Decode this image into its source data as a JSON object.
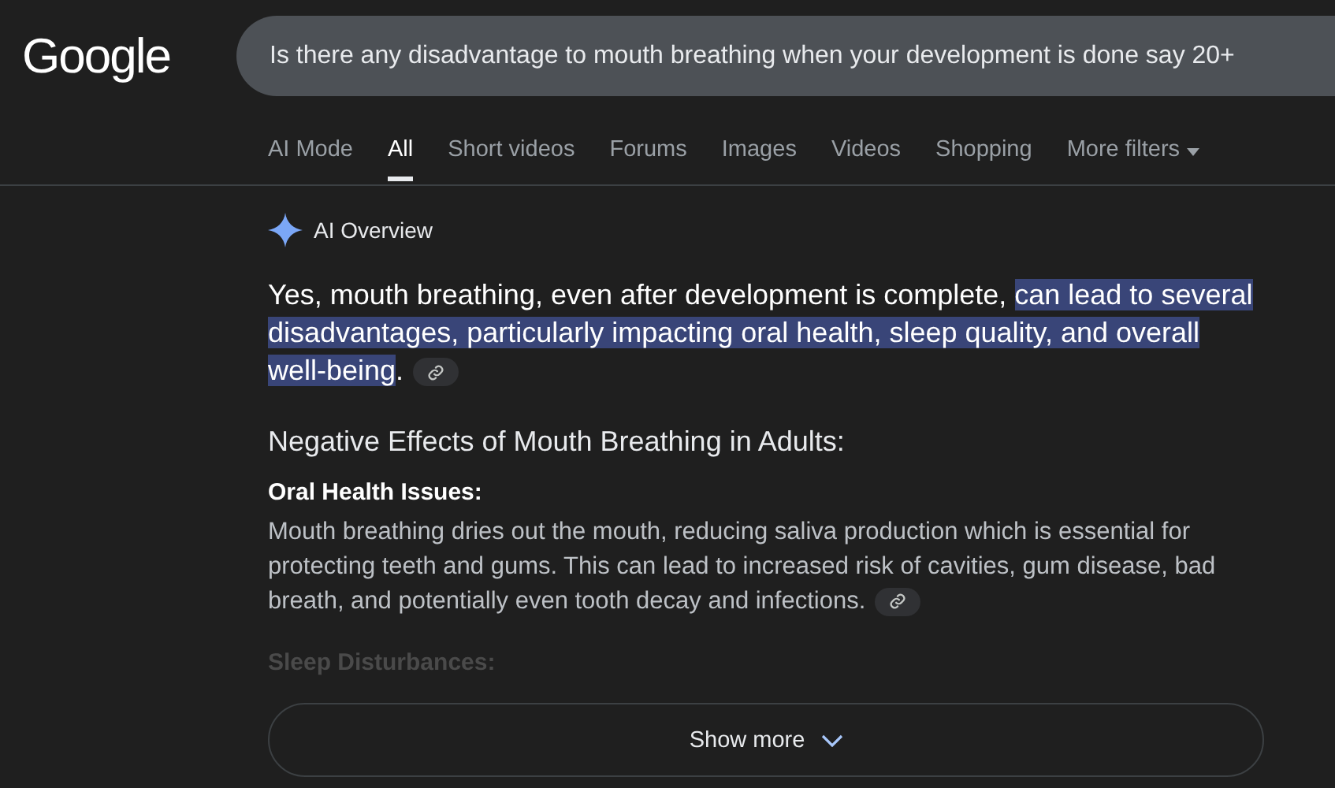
{
  "logo": {
    "text": "Google"
  },
  "search": {
    "value": "Is there any disadvantage to mouth breathing when your development is done say 20+"
  },
  "tabs": [
    {
      "label": "AI Mode",
      "selected": false
    },
    {
      "label": "All",
      "selected": true
    },
    {
      "label": "Short videos",
      "selected": false
    },
    {
      "label": "Forums",
      "selected": false
    },
    {
      "label": "Images",
      "selected": false
    },
    {
      "label": "Videos",
      "selected": false
    },
    {
      "label": "Shopping",
      "selected": false
    },
    {
      "label": "More filters",
      "selected": false,
      "kind": "dropdown"
    }
  ],
  "ai_overview": {
    "title": "AI Overview",
    "summary": [
      {
        "text": "Yes, mouth breathing, even after development is complete, ",
        "highlighted": false
      },
      {
        "text": "can lead to several disadvantages, particularly impacting oral health, sleep quality, and overall well-being",
        "highlighted": true
      },
      {
        "text": ".",
        "highlighted": false
      }
    ],
    "heading": "Negative Effects of Mouth Breathing in Adults:",
    "sections": [
      {
        "title": "Oral Health Issues:",
        "body": "Mouth breathing dries out the mouth, reducing saliva production which is essential for protecting teeth and gums. This can lead to increased risk of cavities, gum disease, bad breath, and potentially even tooth decay and infections.",
        "faded": false
      },
      {
        "title": "Sleep Disturbances:",
        "faded": true
      }
    ],
    "show_more": "Show more"
  }
}
